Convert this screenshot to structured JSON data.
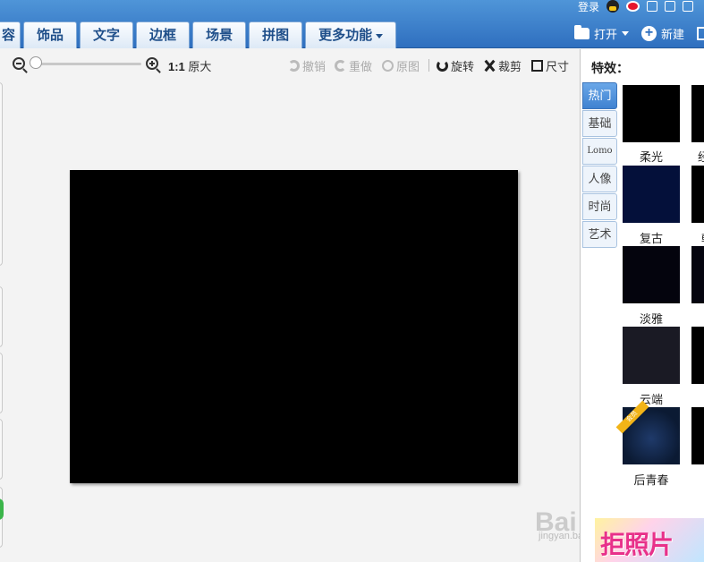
{
  "nav": {
    "tabs": [
      {
        "label": "容"
      },
      {
        "label": "饰品"
      },
      {
        "label": "文字"
      },
      {
        "label": "边框"
      },
      {
        "label": "场景"
      },
      {
        "label": "拼图"
      },
      {
        "label": "更多功能"
      }
    ]
  },
  "account": {
    "login_label": "登录"
  },
  "file": {
    "open_label": "打开",
    "new_label": "新建"
  },
  "toolbar": {
    "ratio_label": "1:1",
    "original_size_label": "原大",
    "undo_label": "撤销",
    "redo_label": "重做",
    "original_label": "原图",
    "rotate_label": "旋转",
    "crop_label": "裁剪",
    "size_label": "尺寸",
    "zoom_level": 0
  },
  "effects": {
    "title": "特效：",
    "categories": [
      "热门",
      "基础",
      "Lomo",
      "人像",
      "时尚",
      "艺术"
    ],
    "active_category": "热门",
    "items": [
      {
        "label": "柔光",
        "color": "#000000"
      },
      {
        "label": "复古",
        "color": "#04103a"
      },
      {
        "label": "淡雅",
        "color": "#04040d"
      },
      {
        "label": "云端",
        "color": "#1a1a24"
      },
      {
        "label": "后青春",
        "color": "#16284a",
        "badge": "会员"
      }
    ],
    "partial_labels": [
      "经",
      "朝"
    ]
  },
  "banner": {
    "text": "拒照片"
  },
  "watermark": {
    "text": "Bai du 经验",
    "sub": "jingyan.baidu.com"
  },
  "colors": {
    "accent": "#2f6fbf",
    "tab_text": "#1f4f8a",
    "active_category": "#3f82d1"
  }
}
